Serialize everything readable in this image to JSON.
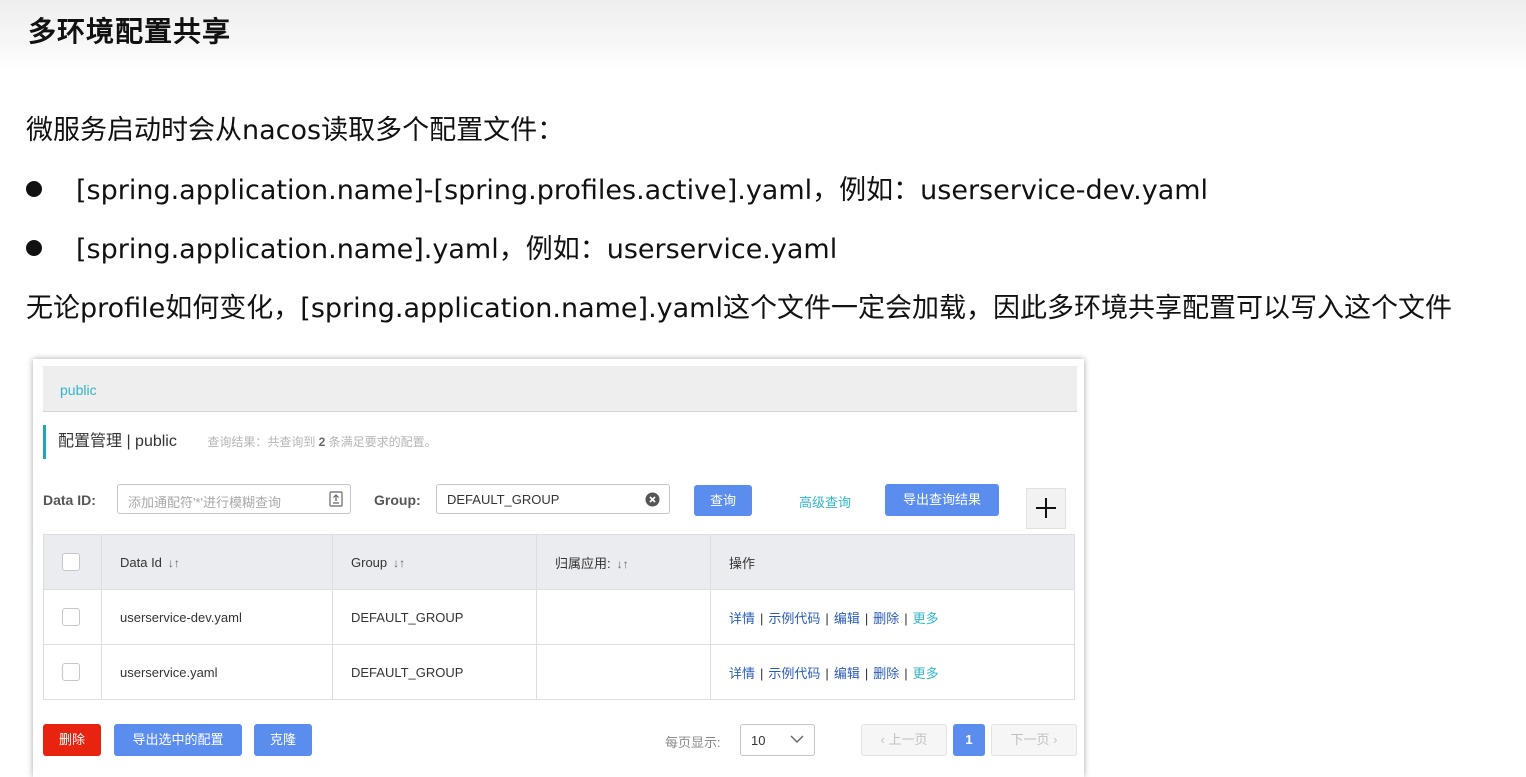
{
  "slide": {
    "title": "多环境配置共享",
    "intro": "微服务启动时会从nacos读取多个配置文件：",
    "bullets": [
      "[spring.application.name]-[spring.profiles.active].yaml，例如：userservice-dev.yaml",
      "[spring.application.name].yaml，例如：userservice.yaml"
    ],
    "conclusion": "无论profile如何变化，[spring.application.name].yaml这个文件一定会加载，因此多环境共享配置可以写入这个文件"
  },
  "nacos": {
    "namespace": "public",
    "title": "配置管理 | public",
    "result_prefix": "查询结果：共查询到 ",
    "result_count": "2",
    "result_suffix": " 条满足要求的配置。",
    "search": {
      "data_id_label": "Data ID:",
      "data_id_placeholder": "添加通配符'*'进行模糊查询",
      "group_label": "Group:",
      "group_value": "DEFAULT_GROUP",
      "query_button": "查询",
      "advanced_query": "高级查询",
      "export_results": "导出查询结果",
      "add_button": "+"
    },
    "table": {
      "headers": [
        "Data Id",
        "Group",
        "归属应用:",
        "操作"
      ],
      "rows": [
        {
          "data_id": "userservice-dev.yaml",
          "group": "DEFAULT_GROUP",
          "app": ""
        },
        {
          "data_id": "userservice.yaml",
          "group": "DEFAULT_GROUP",
          "app": ""
        }
      ],
      "ops": {
        "detail": "详情",
        "sample": "示例代码",
        "edit": "编辑",
        "delete": "删除",
        "more": "更多"
      }
    },
    "footer": {
      "delete_button": "删除",
      "export_selected": "导出选中的配置",
      "clone_button": "克隆",
      "page_size_label": "每页显示:",
      "page_size": "10",
      "prev": "上一页",
      "current_page": "1",
      "next": "下一页"
    }
  },
  "colors": {
    "accent": "#5b8def",
    "danger": "#e8230f",
    "teal": "#33b5c9"
  },
  "icons": [
    "upload-icon",
    "clear-icon",
    "sort-icon",
    "chevron-down-icon",
    "chevron-left-icon",
    "chevron-right-icon",
    "plus-icon"
  ]
}
